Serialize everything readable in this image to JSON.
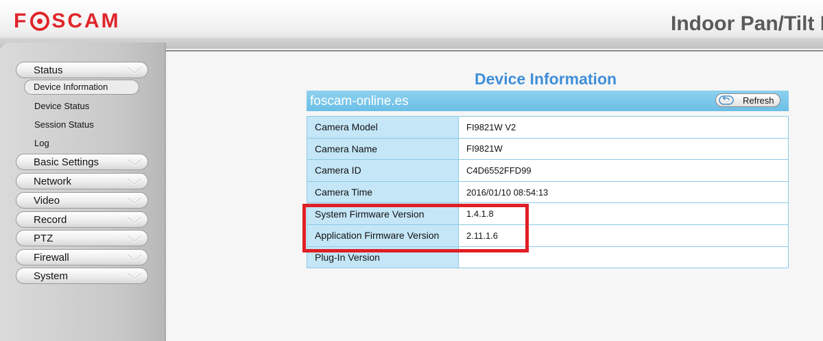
{
  "header": {
    "logo_left": "F",
    "logo_right": "SCAM",
    "title": "Indoor Pan/Tilt I"
  },
  "sidebar": {
    "items": [
      {
        "label": "Status"
      },
      {
        "label": "Basic Settings"
      },
      {
        "label": "Network"
      },
      {
        "label": "Video"
      },
      {
        "label": "Record"
      },
      {
        "label": "PTZ"
      },
      {
        "label": "Firewall"
      },
      {
        "label": "System"
      }
    ],
    "status_sub": [
      {
        "label": "Device Information",
        "active": true
      },
      {
        "label": "Device Status"
      },
      {
        "label": "Session Status"
      },
      {
        "label": "Log"
      }
    ]
  },
  "main": {
    "title": "Device Information",
    "site": "foscam-online.es",
    "refresh_label": "Refresh",
    "rows": [
      {
        "key": "Camera Model",
        "value": "FI9821W V2"
      },
      {
        "key": "Camera Name",
        "value": "FI9821W"
      },
      {
        "key": "Camera ID",
        "value": "C4D6552FFD99"
      },
      {
        "key": "Camera Time",
        "value": "2016/01/10 08:54:13"
      },
      {
        "key": "System Firmware Version",
        "value": "1.4.1.8"
      },
      {
        "key": "Application Firmware Version",
        "value": "2.11.1.6"
      },
      {
        "key": "Plug-In Version",
        "value": ""
      }
    ]
  },
  "colors": {
    "brand_red": "#e0252b",
    "title_blue": "#3f8fd9",
    "bar_blue": "#6bbfe6",
    "highlight_red": "#e01f26"
  }
}
